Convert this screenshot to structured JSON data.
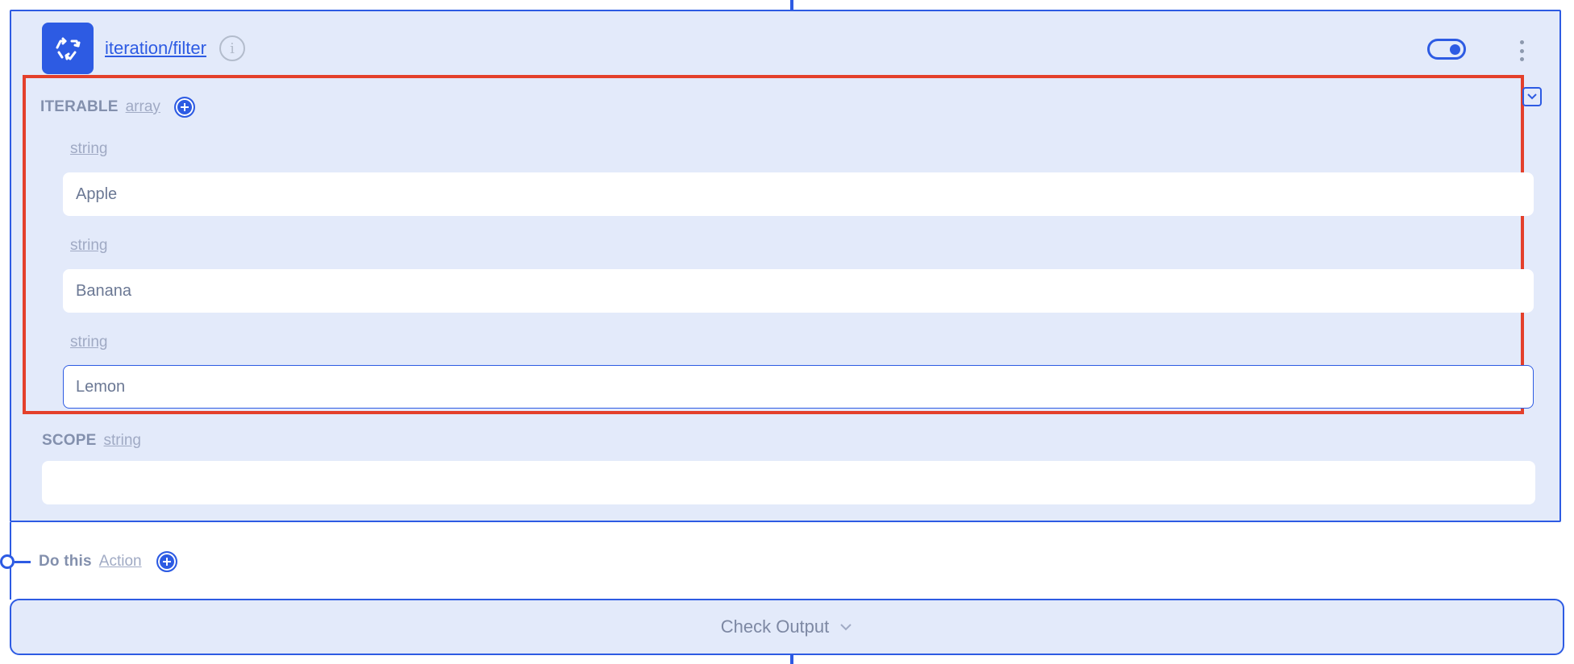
{
  "node": {
    "title": "iteration/filter",
    "info_icon": "i",
    "enabled": true
  },
  "iterable": {
    "label": "ITERABLE",
    "type": "array",
    "items": [
      {
        "type": "string",
        "value": "Apple"
      },
      {
        "type": "string",
        "value": "Banana"
      },
      {
        "type": "string",
        "value": "Lemon"
      }
    ]
  },
  "scope": {
    "label": "SCOPE",
    "type": "string",
    "value": ""
  },
  "do_this": {
    "label": "Do this",
    "type": "Action"
  },
  "check_output": {
    "label": "Check Output"
  },
  "colors": {
    "accent": "#2d5be3",
    "card_bg": "#e3eafa",
    "highlight": "#e4402b",
    "label": "#8390ad"
  },
  "icons": {
    "node_logo": "recycle-arrows-icon",
    "add": "plus-circle-icon",
    "collapse": "chevron-down-icon",
    "menu": "kebab-menu-icon"
  }
}
